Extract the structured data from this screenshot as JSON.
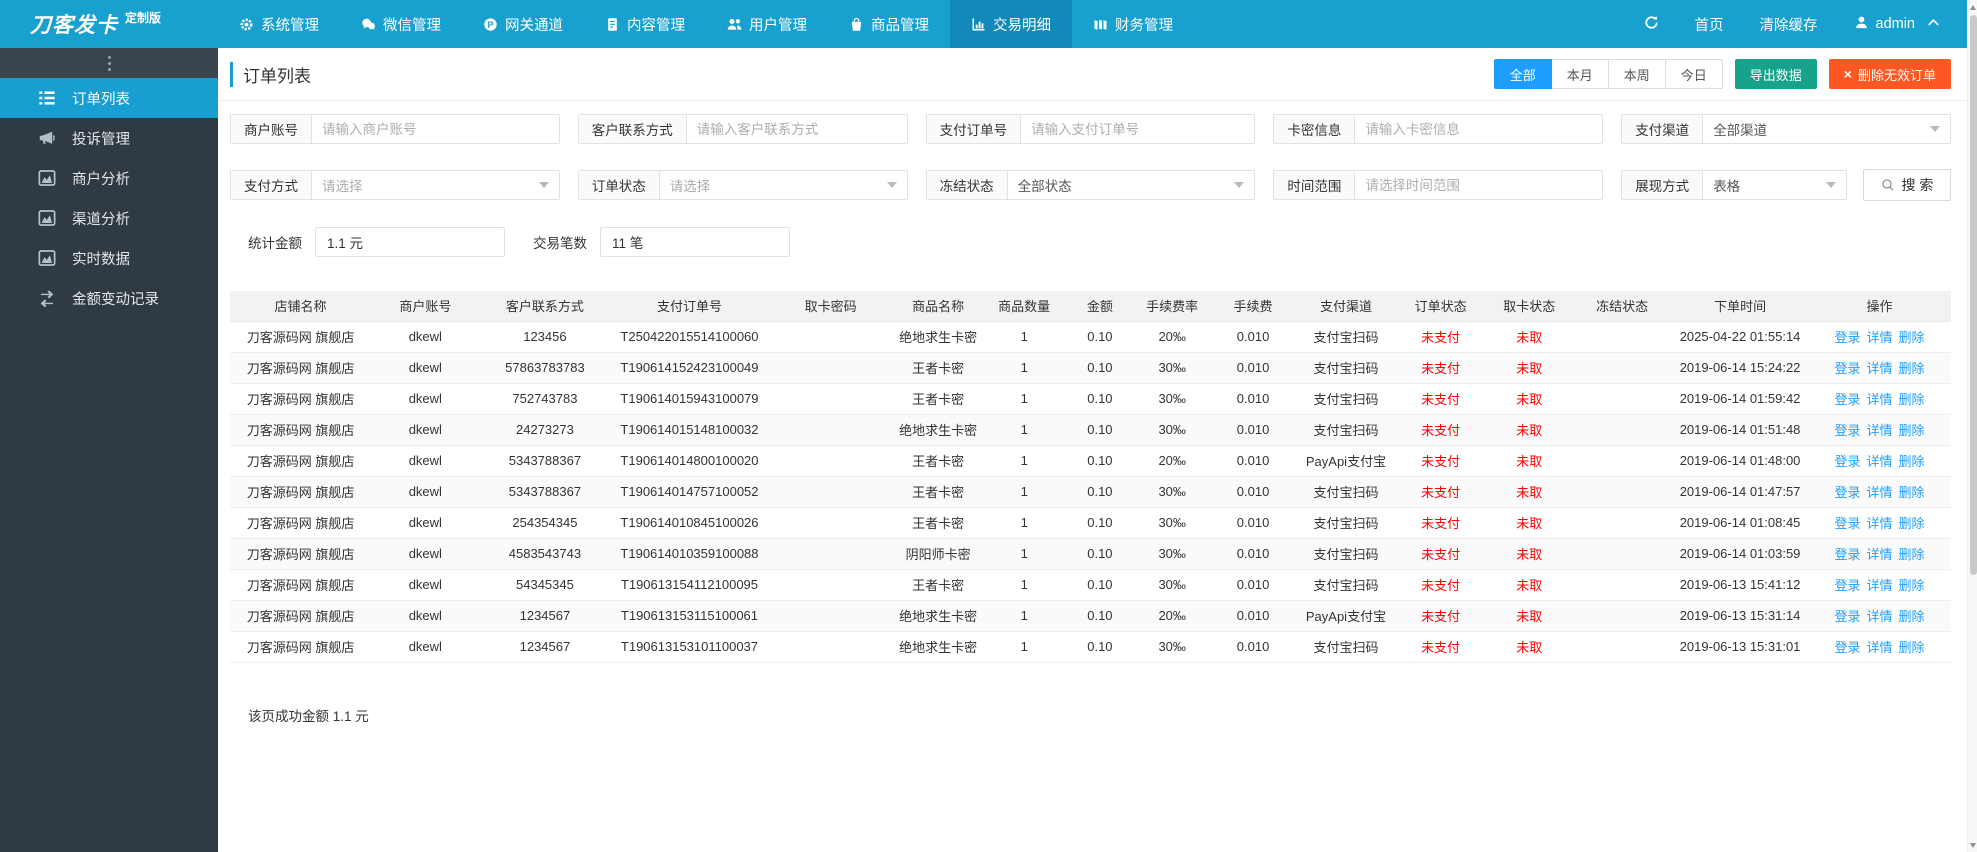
{
  "navbar": {
    "logo": "刀客发卡",
    "logo_badge": "定制版",
    "menu": [
      {
        "key": "system",
        "icon": "gear-icon",
        "label": "系统管理",
        "active": false
      },
      {
        "key": "wechat",
        "icon": "wechat-icon",
        "label": "微信管理",
        "active": false
      },
      {
        "key": "gateway",
        "icon": "gateway-p-icon",
        "label": "网关通道",
        "active": false
      },
      {
        "key": "content",
        "icon": "document-icon",
        "label": "内容管理",
        "active": false
      },
      {
        "key": "users",
        "icon": "users-icon",
        "label": "用户管理",
        "active": false
      },
      {
        "key": "goods",
        "icon": "bag-icon",
        "label": "商品管理",
        "active": false
      },
      {
        "key": "trades",
        "icon": "bar-chart-icon",
        "label": "交易明细",
        "active": true
      },
      {
        "key": "finance",
        "icon": "money-icon",
        "label": "财务管理",
        "active": false
      }
    ],
    "home": "首页",
    "clear_cache": "清除缓存",
    "user": "admin"
  },
  "sidebar": {
    "items": [
      {
        "key": "order-list",
        "icon": "ordered-list-icon",
        "label": "订单列表",
        "active": true
      },
      {
        "key": "complaints",
        "icon": "megaphone-icon",
        "label": "投诉管理",
        "active": false
      },
      {
        "key": "merchant-analysis",
        "icon": "area-chart-icon",
        "label": "商户分析",
        "active": false
      },
      {
        "key": "channel-analysis",
        "icon": "area-chart-icon",
        "label": "渠道分析",
        "active": false
      },
      {
        "key": "realtime-data",
        "icon": "area-chart-icon",
        "label": "实时数据",
        "active": false
      },
      {
        "key": "balance-log",
        "icon": "exchange-icon",
        "label": "金额变动记录",
        "active": false
      }
    ]
  },
  "page": {
    "title": "订单列表",
    "range_buttons": [
      {
        "key": "all",
        "label": "全部",
        "active": true
      },
      {
        "key": "month",
        "label": "本月",
        "active": false
      },
      {
        "key": "week",
        "label": "本周",
        "active": false
      },
      {
        "key": "today",
        "label": "今日",
        "active": false
      }
    ],
    "export_button": "导出数据",
    "delete_button": "删除无效订单"
  },
  "filters": {
    "row1": [
      {
        "key": "merchant-account",
        "type": "input",
        "label": "商户账号",
        "placeholder": "请输入商户账号"
      },
      {
        "key": "customer-contact",
        "type": "input",
        "label": "客户联系方式",
        "placeholder": "请输入客户联系方式"
      },
      {
        "key": "pay-order-no",
        "type": "input",
        "label": "支付订单号",
        "placeholder": "请输入支付订单号"
      },
      {
        "key": "card-info",
        "type": "input",
        "label": "卡密信息",
        "placeholder": "请输入卡密信息"
      },
      {
        "key": "pay-channel",
        "type": "select",
        "label": "支付渠道",
        "value": "全部渠道",
        "muted": false
      }
    ],
    "row2": [
      {
        "key": "pay-method",
        "type": "select",
        "label": "支付方式",
        "value": "请选择",
        "muted": true
      },
      {
        "key": "order-status",
        "type": "select",
        "label": "订单状态",
        "value": "请选择",
        "muted": true
      },
      {
        "key": "freeze-status",
        "type": "select",
        "label": "冻结状态",
        "value": "全部状态",
        "muted": false
      },
      {
        "key": "time-range",
        "type": "input",
        "label": "时间范围",
        "placeholder": "请选择时间范围"
      },
      {
        "key": "display-mode",
        "type": "select",
        "label": "展现方式",
        "value": "表格",
        "muted": false
      }
    ],
    "search_button": "搜 索",
    "stats": [
      {
        "key": "total-amount",
        "label": "统计金额",
        "value": "1.1 元"
      },
      {
        "key": "trade-count",
        "label": "交易笔数",
        "value": "11 笔"
      }
    ]
  },
  "table": {
    "headers": [
      "店铺名称",
      "商户账号",
      "客户联系方式",
      "支付订单号",
      "取卡密码",
      "商品名称",
      "商品数量",
      "金额",
      "手续费率",
      "手续费",
      "支付渠道",
      "订单状态",
      "取卡状态",
      "冻结状态",
      "下单时间",
      "操作"
    ],
    "actions": [
      "登录",
      "详情",
      "删除"
    ],
    "rows": [
      {
        "shop": "刀客源码网 旗舰店",
        "account": "dkewl",
        "contact": "123456",
        "order_no": "T250422015514100060",
        "card_pwd": "",
        "product": "绝地求生卡密",
        "qty": "1",
        "amount": "0.10",
        "fee_rate": "20‰",
        "fee": "0.010",
        "channel": "支付宝扫码",
        "order_status": "未支付",
        "card_status": "未取",
        "freeze_status": "",
        "time": "2025-04-22 01:55:14"
      },
      {
        "shop": "刀客源码网 旗舰店",
        "account": "dkewl",
        "contact": "57863783783",
        "order_no": "T190614152423100049",
        "card_pwd": "",
        "product": "王者卡密",
        "qty": "1",
        "amount": "0.10",
        "fee_rate": "30‰",
        "fee": "0.010",
        "channel": "支付宝扫码",
        "order_status": "未支付",
        "card_status": "未取",
        "freeze_status": "",
        "time": "2019-06-14 15:24:22"
      },
      {
        "shop": "刀客源码网 旗舰店",
        "account": "dkewl",
        "contact": "752743783",
        "order_no": "T190614015943100079",
        "card_pwd": "",
        "product": "王者卡密",
        "qty": "1",
        "amount": "0.10",
        "fee_rate": "30‰",
        "fee": "0.010",
        "channel": "支付宝扫码",
        "order_status": "未支付",
        "card_status": "未取",
        "freeze_status": "",
        "time": "2019-06-14 01:59:42"
      },
      {
        "shop": "刀客源码网 旗舰店",
        "account": "dkewl",
        "contact": "24273273",
        "order_no": "T190614015148100032",
        "card_pwd": "",
        "product": "绝地求生卡密",
        "qty": "1",
        "amount": "0.10",
        "fee_rate": "30‰",
        "fee": "0.010",
        "channel": "支付宝扫码",
        "order_status": "未支付",
        "card_status": "未取",
        "freeze_status": "",
        "time": "2019-06-14 01:51:48"
      },
      {
        "shop": "刀客源码网 旗舰店",
        "account": "dkewl",
        "contact": "5343788367",
        "order_no": "T190614014800100020",
        "card_pwd": "",
        "product": "王者卡密",
        "qty": "1",
        "amount": "0.10",
        "fee_rate": "20‰",
        "fee": "0.010",
        "channel": "PayApi支付宝",
        "order_status": "未支付",
        "card_status": "未取",
        "freeze_status": "",
        "time": "2019-06-14 01:48:00"
      },
      {
        "shop": "刀客源码网 旗舰店",
        "account": "dkewl",
        "contact": "5343788367",
        "order_no": "T190614014757100052",
        "card_pwd": "",
        "product": "王者卡密",
        "qty": "1",
        "amount": "0.10",
        "fee_rate": "30‰",
        "fee": "0.010",
        "channel": "支付宝扫码",
        "order_status": "未支付",
        "card_status": "未取",
        "freeze_status": "",
        "time": "2019-06-14 01:47:57"
      },
      {
        "shop": "刀客源码网 旗舰店",
        "account": "dkewl",
        "contact": "254354345",
        "order_no": "T190614010845100026",
        "card_pwd": "",
        "product": "王者卡密",
        "qty": "1",
        "amount": "0.10",
        "fee_rate": "30‰",
        "fee": "0.010",
        "channel": "支付宝扫码",
        "order_status": "未支付",
        "card_status": "未取",
        "freeze_status": "",
        "time": "2019-06-14 01:08:45"
      },
      {
        "shop": "刀客源码网 旗舰店",
        "account": "dkewl",
        "contact": "4583543743",
        "order_no": "T190614010359100088",
        "card_pwd": "",
        "product": "阴阳师卡密",
        "qty": "1",
        "amount": "0.10",
        "fee_rate": "30‰",
        "fee": "0.010",
        "channel": "支付宝扫码",
        "order_status": "未支付",
        "card_status": "未取",
        "freeze_status": "",
        "time": "2019-06-14 01:03:59"
      },
      {
        "shop": "刀客源码网 旗舰店",
        "account": "dkewl",
        "contact": "54345345",
        "order_no": "T190613154112100095",
        "card_pwd": "",
        "product": "王者卡密",
        "qty": "1",
        "amount": "0.10",
        "fee_rate": "30‰",
        "fee": "0.010",
        "channel": "支付宝扫码",
        "order_status": "未支付",
        "card_status": "未取",
        "freeze_status": "",
        "time": "2019-06-13 15:41:12"
      },
      {
        "shop": "刀客源码网 旗舰店",
        "account": "dkewl",
        "contact": "1234567",
        "order_no": "T190613153115100061",
        "card_pwd": "",
        "product": "绝地求生卡密",
        "qty": "1",
        "amount": "0.10",
        "fee_rate": "20‰",
        "fee": "0.010",
        "channel": "PayApi支付宝",
        "order_status": "未支付",
        "card_status": "未取",
        "freeze_status": "",
        "time": "2019-06-13 15:31:14"
      },
      {
        "shop": "刀客源码网 旗舰店",
        "account": "dkewl",
        "contact": "1234567",
        "order_no": "T190613153101100037",
        "card_pwd": "",
        "product": "绝地求生卡密",
        "qty": "1",
        "amount": "0.10",
        "fee_rate": "30‰",
        "fee": "0.010",
        "channel": "支付宝扫码",
        "order_status": "未支付",
        "card_status": "未取",
        "freeze_status": "",
        "time": "2019-06-13 15:31:01"
      }
    ]
  },
  "footer": {
    "summary": "该页成功金额 1.1 元"
  },
  "colors": {
    "navbar": "#18A0CE",
    "navbar_active": "#1289B8",
    "sidebar": "#2F3A43",
    "accent_blue": "#1E9FFF",
    "export_green": "#17A28B",
    "delete_orange": "#FF5722",
    "status_red": "#FF0000",
    "link_blue": "#1E9FFF"
  }
}
